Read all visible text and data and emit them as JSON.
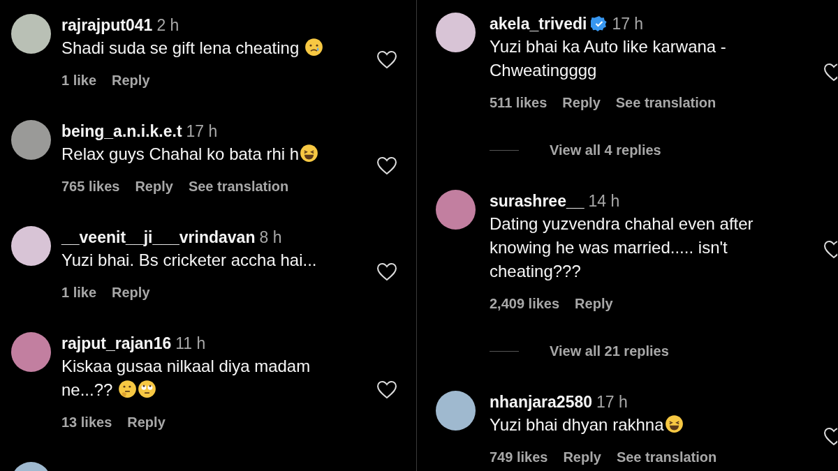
{
  "columns": [
    {
      "comments": [
        {
          "kind": "full",
          "username": "rajrajput041",
          "verified": false,
          "time": "2 h",
          "text": "Shadi suda se gift lena cheating ",
          "emojis": [
            {
              "kind": "tear"
            }
          ],
          "likes": "1 like",
          "actions": [
            "Reply"
          ]
        },
        {
          "kind": "full",
          "username": "being_a.n.i.k.e.t",
          "verified": false,
          "time": "17 h",
          "text": "Relax guys Chahal ko bata rhi h",
          "emojis": [
            {
              "kind": "laugh"
            }
          ],
          "likes": "765 likes",
          "actions": [
            "Reply",
            "See translation"
          ]
        },
        {
          "kind": "full",
          "username": "__veenit__ji___vrindavan",
          "verified": false,
          "time": "8 h",
          "text": "Yuzi bhai. Bs cricketer accha hai...",
          "likes": "1 like",
          "actions": [
            "Reply"
          ]
        },
        {
          "kind": "full",
          "username": "rajput_rajan16",
          "verified": false,
          "time": "11 h",
          "text": "Kiskaa gusaa nilkaal diya madam ne...?? ",
          "emojis": [
            {
              "kind": "thinking"
            },
            {
              "kind": "eyeroll"
            }
          ],
          "likes": "13 likes",
          "actions": [
            "Reply"
          ]
        },
        {
          "kind": "partial"
        }
      ]
    },
    {
      "comments": [
        {
          "kind": "full",
          "username": "akela_trivedi",
          "verified": true,
          "time": "17 h",
          "text": "Yuzi bhai ka Auto like karwana - Chweatingggg",
          "likes": "511 likes",
          "actions": [
            "Reply",
            "See translation"
          ],
          "view_replies": "View all 4 replies"
        },
        {
          "kind": "full",
          "username": "surashree__",
          "verified": false,
          "time": "14 h",
          "text": "Dating yuzvendra chahal even after knowing he was married..... isn't cheating???",
          "likes": "2,409 likes",
          "actions": [
            "Reply"
          ],
          "view_replies": "View all 21 replies"
        },
        {
          "kind": "full",
          "username": "nhanjara2580",
          "verified": false,
          "time": "17 h",
          "text": "Yuzi bhai dhyan rakhna",
          "emojis": [
            {
              "kind": "laugh"
            }
          ],
          "likes": "749 likes",
          "actions": [
            "Reply",
            "See translation"
          ]
        }
      ]
    }
  ]
}
